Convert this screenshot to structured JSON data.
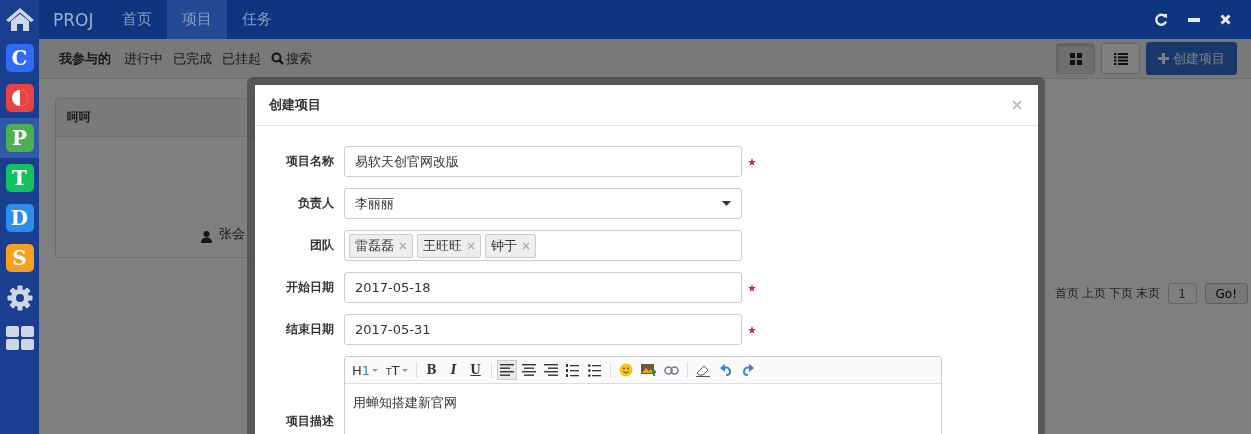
{
  "sidebar": {
    "apps": [
      {
        "kind": "home",
        "selected": false
      },
      {
        "kind": "letter",
        "letter": "C",
        "color": "#2f6df6",
        "selected": false
      },
      {
        "kind": "half-circle",
        "color": "#e94242",
        "selected": false
      },
      {
        "kind": "letter",
        "letter": "P",
        "color": "#4caf50",
        "selected": true
      },
      {
        "kind": "letter",
        "letter": "T",
        "color": "#11c35f",
        "selected": false
      },
      {
        "kind": "letter",
        "letter": "D",
        "color": "#2d8cf0",
        "selected": false
      },
      {
        "kind": "letter",
        "letter": "S",
        "color": "#f5a01a",
        "selected": false
      },
      {
        "kind": "gear",
        "selected": false
      },
      {
        "kind": "grid",
        "selected": false
      }
    ]
  },
  "topbar": {
    "brand": "PROJ",
    "tabs": [
      {
        "label": "首页",
        "selected": false
      },
      {
        "label": "项目",
        "selected": true
      },
      {
        "label": "任务",
        "selected": false
      }
    ]
  },
  "filters": [
    {
      "label": "我参与的",
      "selected": true,
      "search": false
    },
    {
      "label": "进行中",
      "selected": false,
      "search": false
    },
    {
      "label": "已完成",
      "selected": false,
      "search": false
    },
    {
      "label": "已挂起",
      "selected": false,
      "search": false
    },
    {
      "label": "搜索",
      "selected": false,
      "search": true
    }
  ],
  "view_buttons": [
    {
      "kind": "grid",
      "selected": true
    },
    {
      "kind": "list",
      "selected": false
    }
  ],
  "create_button": "创建项目",
  "card": {
    "title": "呵呵",
    "owner": "张会"
  },
  "pagination": {
    "links": [
      "首页",
      "上页",
      "下页",
      "末页"
    ],
    "page": "1",
    "go": "Go!"
  },
  "dialog": {
    "title": "创建项目",
    "fields": [
      {
        "kind": "text",
        "label": "项目名称",
        "value": "易软天创官网改版",
        "required": true
      },
      {
        "kind": "select",
        "label": "负责人",
        "value": "李丽丽",
        "required": false
      },
      {
        "kind": "tags",
        "label": "团队",
        "tags": [
          "雷磊磊",
          "王旺旺",
          "钟于"
        ],
        "required": false
      },
      {
        "kind": "text",
        "label": "开始日期",
        "value": "2017-05-18",
        "required": true
      },
      {
        "kind": "text",
        "label": "结束日期",
        "value": "2017-05-31",
        "required": true
      }
    ],
    "description": {
      "label": "项目描述",
      "value": "用蝉知搭建新官网",
      "toolbar": [
        [
          {
            "kind": "heading",
            "label": "H1"
          },
          {
            "kind": "size",
            "label": "TT"
          }
        ],
        [
          {
            "kind": "bold",
            "label": "B"
          },
          {
            "kind": "italic",
            "label": "I"
          },
          {
            "kind": "underline",
            "label": "U"
          }
        ],
        [
          {
            "kind": "align-left",
            "active": true
          },
          {
            "kind": "align-center",
            "active": false
          },
          {
            "kind": "align-right",
            "active": false
          },
          {
            "kind": "ordered-list",
            "active": false
          },
          {
            "kind": "bullet-list",
            "active": false
          }
        ],
        [
          {
            "kind": "emoji",
            "active": false
          },
          {
            "kind": "image",
            "active": false
          },
          {
            "kind": "link",
            "active": false
          }
        ],
        [
          {
            "kind": "eraser",
            "active": false
          },
          {
            "kind": "undo",
            "active": false
          },
          {
            "kind": "redo",
            "active": false
          }
        ]
      ]
    }
  }
}
